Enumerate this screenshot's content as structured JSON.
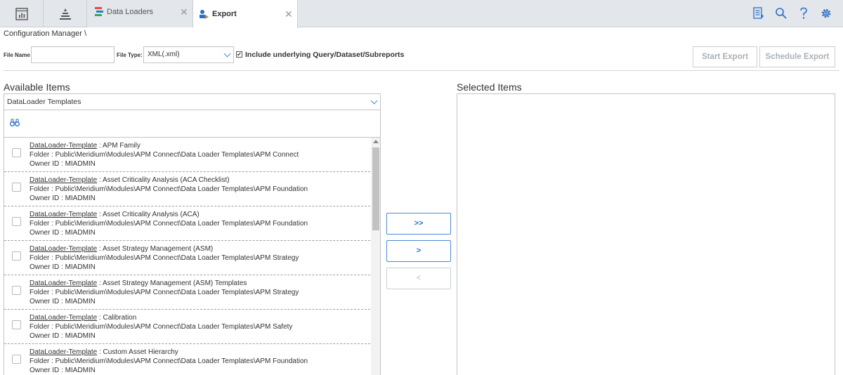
{
  "tabs": [
    {
      "label": "Data Loaders",
      "icon": "data-loaders-icon",
      "close": "✕"
    },
    {
      "label": "Export",
      "icon": "export-icon",
      "close": "✕"
    }
  ],
  "header_icons": [
    "report-icon",
    "search-icon",
    "help-icon",
    "settings-icon"
  ],
  "breadcrumb": "Configuration Manager \\",
  "form": {
    "file_name_label": "File Name",
    "file_name_value": "",
    "file_type_label": "File Type:",
    "file_type_value": "XML(.xml)",
    "include_checked": true,
    "include_label": "Include underlying Query/Dataset/Subreports",
    "start_export": "Start Export",
    "schedule_export": "Schedule Export"
  },
  "available": {
    "title": "Available Items",
    "type_value": "DataLoader Templates",
    "items": [
      {
        "type": "DataLoader-Template",
        "name": " : APM Family",
        "folder": "Folder : Public\\Meridium\\Modules\\APM Connect\\Data Loader Templates\\APM Connect",
        "owner": "Owner ID : MIADMIN"
      },
      {
        "type": "DataLoader-Template",
        "name": " : Asset Criticality Analysis (ACA Checklist)",
        "folder": "Folder : Public\\Meridium\\Modules\\APM Connect\\Data Loader Templates\\APM Foundation",
        "owner": "Owner ID : MIADMIN"
      },
      {
        "type": "DataLoader-Template",
        "name": " : Asset Criticality Analysis (ACA)",
        "folder": "Folder : Public\\Meridium\\Modules\\APM Connect\\Data Loader Templates\\APM Foundation",
        "owner": "Owner ID : MIADMIN"
      },
      {
        "type": "DataLoader-Template",
        "name": " : Asset Strategy Management (ASM)",
        "folder": "Folder : Public\\Meridium\\Modules\\APM Connect\\Data Loader Templates\\APM Strategy",
        "owner": "Owner ID : MIADMIN"
      },
      {
        "type": "DataLoader-Template",
        "name": " : Asset Strategy Management (ASM) Templates",
        "folder": "Folder : Public\\Meridium\\Modules\\APM Connect\\Data Loader Templates\\APM Strategy",
        "owner": "Owner ID : MIADMIN"
      },
      {
        "type": "DataLoader-Template",
        "name": " : Calibration",
        "folder": "Folder : Public\\Meridium\\Modules\\APM Connect\\Data Loader Templates\\APM Safety",
        "owner": "Owner ID : MIADMIN"
      },
      {
        "type": "DataLoader-Template",
        "name": " : Custom Asset Hierarchy",
        "folder": "Folder : Public\\Meridium\\Modules\\APM Connect\\Data Loader Templates\\APM Foundation",
        "owner": "Owner ID : MIADMIN"
      }
    ]
  },
  "move_buttons": {
    "add_all": ">>",
    "add": ">",
    "remove": "<"
  },
  "selected": {
    "title": "Selected Items"
  }
}
